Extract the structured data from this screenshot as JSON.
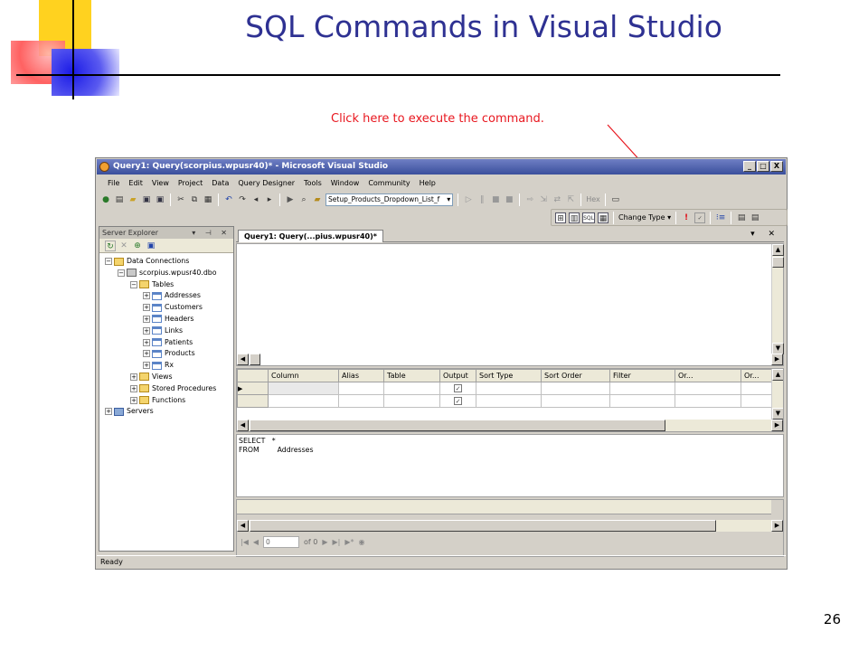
{
  "slide": {
    "title": "SQL Commands in Visual Studio",
    "annotation": "Click here to execute the command.",
    "page_number": "26"
  },
  "window": {
    "title": "Query1: Query(scorpius.wpusr40)* - Microsoft Visual Studio",
    "controls": [
      "_",
      "□",
      "X"
    ],
    "menu": [
      "File",
      "Edit",
      "View",
      "Project",
      "Data",
      "Query Designer",
      "Tools",
      "Window",
      "Community",
      "Help"
    ],
    "toolbar": {
      "config_combo": "Setup_Products_Dropdown_List_f",
      "hex_label": "Hex",
      "change_type_label": "Change Type",
      "sql_label": "SQL"
    },
    "status": "Ready"
  },
  "server_explorer": {
    "title": "Server Explorer",
    "header_buttons": "▾ ⊣ ✕",
    "tree": {
      "data_connections": "Data Connections",
      "connection": "scorpius.wpusr40.dbo",
      "tables": "Tables",
      "table_items": [
        "Addresses",
        "Customers",
        "Headers",
        "Links",
        "Patients",
        "Products",
        "Rx"
      ],
      "views": "Views",
      "stored_procedures": "Stored Procedures",
      "functions": "Functions",
      "servers": "Servers"
    }
  },
  "document": {
    "tab_label": "Query1: Query(...pius.wpusr40)*",
    "tab_controls": "▾ ✕",
    "criteria_columns": [
      "",
      "Column",
      "Alias",
      "Table",
      "Output",
      "Sort Type",
      "Sort Order",
      "Filter",
      "Or...",
      "Or..."
    ],
    "sql_line1": "SELECT   *",
    "sql_line2": "FROM        Addresses",
    "nav": {
      "position": "0",
      "of_label": "of 0"
    }
  }
}
